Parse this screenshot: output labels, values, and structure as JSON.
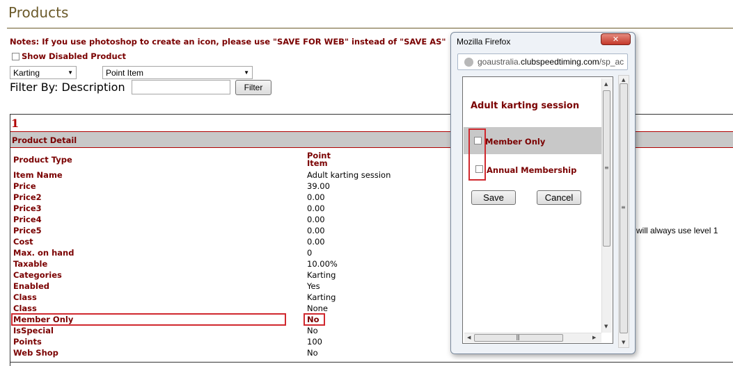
{
  "page": {
    "title": "Products",
    "notes": "Notes: If you use photoshop to create an icon, please use \"SAVE FOR WEB\" instead of \"SAVE AS\"",
    "show_disabled_label": "Show Disabled Product"
  },
  "filters": {
    "category_selected": "Karting",
    "type_selected": "Point Item",
    "filter_by_label": "Filter By: Description",
    "description_value": "",
    "filter_button": "Filter"
  },
  "detail": {
    "record_number": "1",
    "header": "Product Detail",
    "rows": [
      {
        "label": "Product Type",
        "value": "Point Item"
      },
      {
        "label": "Item Name",
        "value": "Adult karting session"
      },
      {
        "label": "Price",
        "value": "39.00"
      },
      {
        "label": "Price2",
        "value": "0.00"
      },
      {
        "label": "Price3",
        "value": "0.00"
      },
      {
        "label": "Price4",
        "value": "0.00"
      },
      {
        "label": "Price5",
        "value": "0.00"
      },
      {
        "label": "Cost",
        "value": "0.00"
      },
      {
        "label": "Max. on hand",
        "value": "0"
      },
      {
        "label": "Taxable",
        "value": "10.00%"
      },
      {
        "label": "Categories",
        "value": "Karting"
      },
      {
        "label": "Enabled",
        "value": "Yes"
      },
      {
        "label": "Class",
        "value": "Karting"
      },
      {
        "label": "Class",
        "value": "None"
      },
      {
        "label": "Member Only",
        "value": "No"
      },
      {
        "label": "IsSpecial",
        "value": "No"
      },
      {
        "label": "Points",
        "value": "100"
      },
      {
        "label": "Web Shop",
        "value": "No"
      }
    ],
    "partial_note": "will always use level 1"
  },
  "popup": {
    "window_title": "Mozilla Firefox",
    "close_glyph": "✕",
    "url_prefix": "goaustralia.",
    "url_host": "clubspeedtiming.com",
    "url_path": "/sp_ac",
    "heading": "Adult karting session",
    "options": [
      {
        "label": "Member Only",
        "checked": false
      },
      {
        "label": "Annual Membership",
        "checked": false
      }
    ],
    "save_button": "Save",
    "cancel_button": "Cancel"
  },
  "colors": {
    "label_red": "#7a0000",
    "highlight_red": "#d0282e",
    "header_gray": "#c8c8c8"
  }
}
